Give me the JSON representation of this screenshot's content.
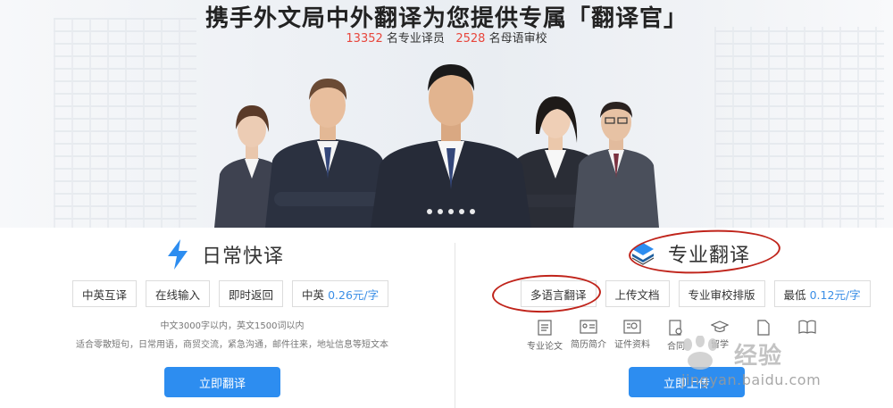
{
  "hero": {
    "title": "携手外文局中外翻译为您提供专属「翻译官」",
    "stat1_num": "13352",
    "stat1_text": "名专业译员",
    "stat2_num": "2528",
    "stat2_text": "名母语审校",
    "carousel_dots": 5
  },
  "daily": {
    "title": "日常快译",
    "icon": "lightning-icon",
    "tags": [
      "中英互译",
      "在线输入",
      "即时返回"
    ],
    "price_label": "中英",
    "price_value": "0.26元/字",
    "note1": "中文3000字以内，英文1500词以内",
    "note2": "适合零散短句，日常用语，商贸交流，紧急沟通，邮件往来，地址信息等短文本",
    "button": "立即翻译"
  },
  "pro": {
    "title": "专业翻译",
    "icon": "layers-icon",
    "tags": [
      "多语言翻译",
      "上传文档",
      "专业审校排版"
    ],
    "price_label": "最低",
    "price_value": "0.12元/字",
    "doc_types": [
      "专业论文",
      "简历简介",
      "证件资料",
      "合同",
      "留学",
      "",
      ""
    ],
    "button": "立即上传"
  },
  "watermark": {
    "cn": "经验",
    "url": "jingyan.baidu.com"
  },
  "colors": {
    "accent": "#2d8df0",
    "price": "#3a8ee6",
    "stat": "#e8463c",
    "annotation": "#c0241b"
  }
}
